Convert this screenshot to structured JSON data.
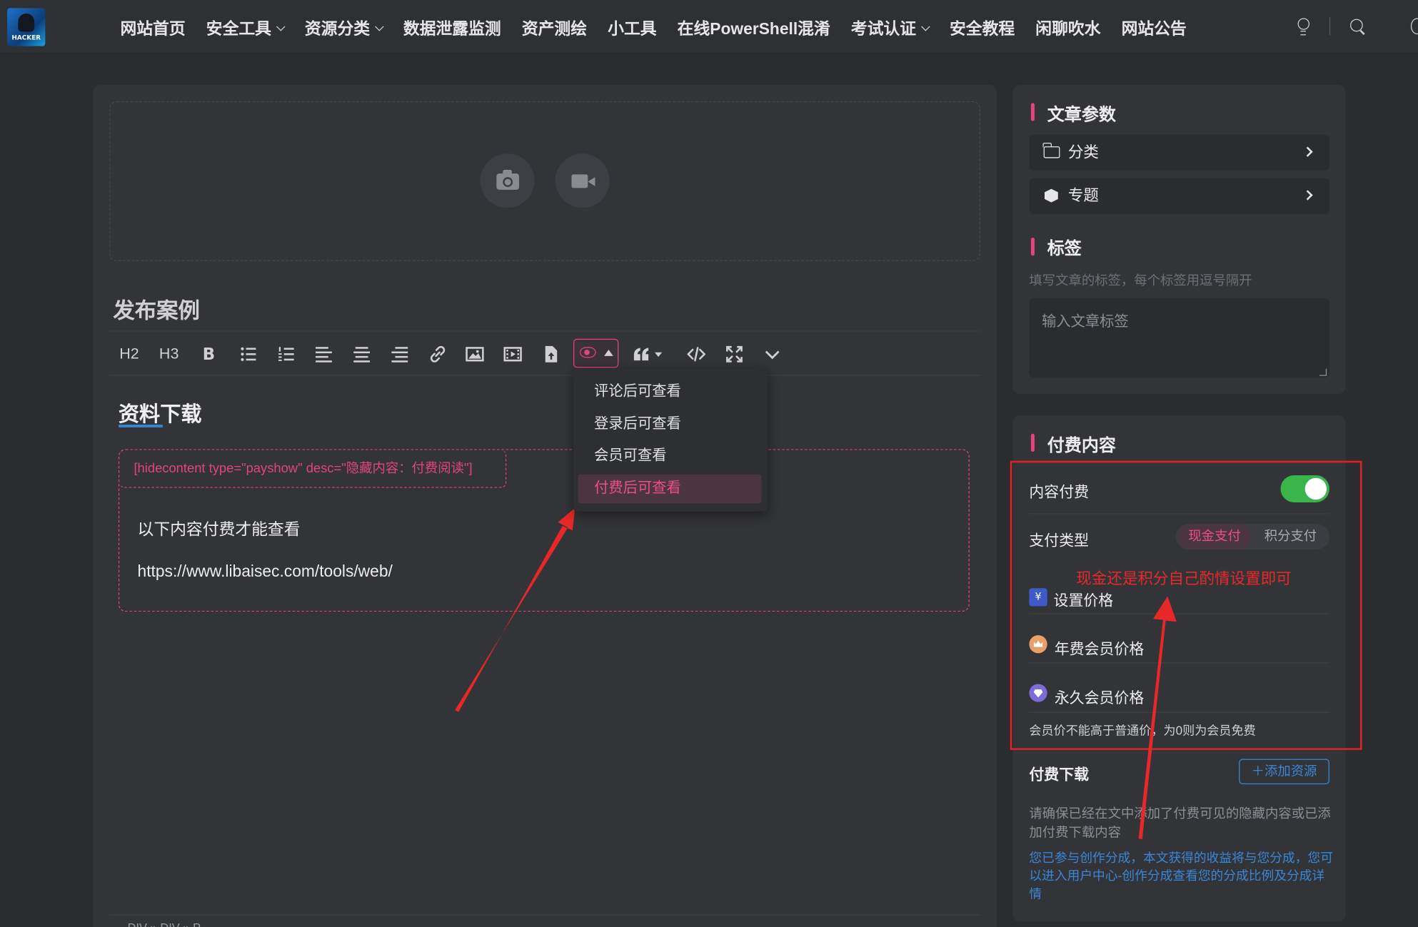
{
  "nav": {
    "logo_text": "HACKER",
    "items": [
      {
        "label": "网站首页",
        "dropdown": false
      },
      {
        "label": "安全工具",
        "dropdown": true
      },
      {
        "label": "资源分类",
        "dropdown": true
      },
      {
        "label": "数据泄露监测",
        "dropdown": false
      },
      {
        "label": "资产测绘",
        "dropdown": false
      },
      {
        "label": "小工具",
        "dropdown": false
      },
      {
        "label": "在线PowerShell混淆",
        "dropdown": false
      },
      {
        "label": "考试认证",
        "dropdown": true
      },
      {
        "label": "安全教程",
        "dropdown": false
      },
      {
        "label": "闲聊吹水",
        "dropdown": false
      },
      {
        "label": "网站公告",
        "dropdown": false
      }
    ]
  },
  "editor": {
    "post_title": "发布案例",
    "toolbar": {
      "h2": "H2",
      "h3": "H3",
      "bold": "B"
    },
    "visibility_menu": [
      {
        "label": "评论后可查看",
        "active": false
      },
      {
        "label": "登录后可查看",
        "active": false
      },
      {
        "label": "会员可查看",
        "active": false
      },
      {
        "label": "付费后可查看",
        "active": true
      }
    ],
    "content_heading": "资料下载",
    "shortcode": "[hidecontent type=\"payshow\" desc=\"隐藏内容：付费阅读\"]",
    "hidden_text": "以下内容付费才能查看",
    "hidden_link": "https://www.libaisec.com/tools/web/",
    "statusbar": "DIV » DIV » P"
  },
  "sidebar": {
    "article_params_title": "文章参数",
    "category_label": "分类",
    "topic_label": "专题",
    "tags_title": "标签",
    "tags_hint": "填写文章的标签，每个标签用逗号隔开",
    "tags_placeholder": "输入文章标签",
    "paid_title": "付费内容",
    "content_paid_label": "内容付费",
    "content_paid_on": true,
    "pay_type_label": "支付类型",
    "pay_cash": "现金支付",
    "pay_points": "积分支付",
    "set_price_label": "设置价格",
    "annual_price_label": "年费会员价格",
    "lifetime_price_label": "永久会员价格",
    "member_note": "会员价不能高于普通价，为0则为会员免费",
    "paid_download_label": "付费下载",
    "add_resource_button": "＋添加资源",
    "paid_download_hint": "请确保已经在文中添加了付费可见的隐藏内容或已添加付费下载内容",
    "revenue_share_note": "您已参与创作分成，本文获得的收益将与您分成，您可以进入用户中心-创作分成查看您的分成比例及分成详情"
  },
  "annotation": {
    "text": "现金还是积分自己酌情设置即可",
    "color": "#e82828"
  },
  "colors": {
    "accent": "#e0457b",
    "toggle_on": "#3ab54a",
    "link_blue": "#3a86d6"
  }
}
